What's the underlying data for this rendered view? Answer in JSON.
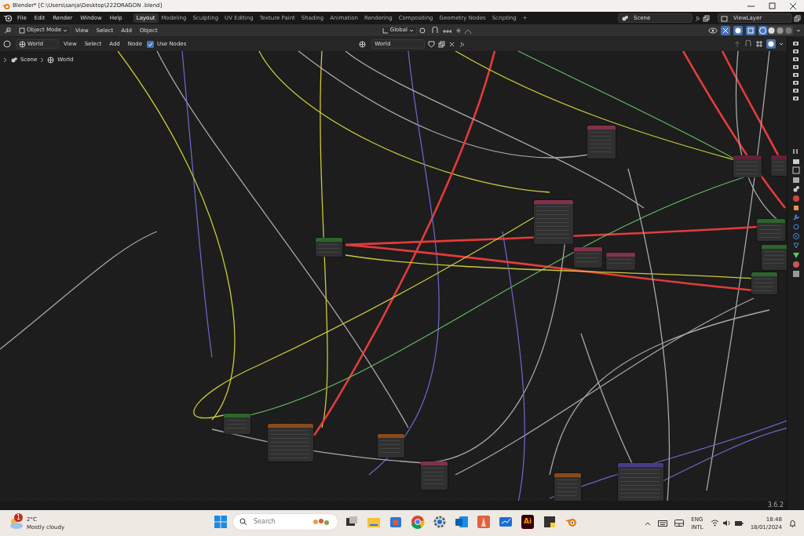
{
  "window": {
    "title": "Blender* [C:\\Users\\sanja\\Desktop\\222DRAGON .blend]"
  },
  "menus": [
    "File",
    "Edit",
    "Render",
    "Window",
    "Help"
  ],
  "workspaces": [
    {
      "label": "Layout",
      "selected": true
    },
    {
      "label": "Modeling",
      "selected": false
    },
    {
      "label": "Sculpting",
      "selected": false
    },
    {
      "label": "UV Editing",
      "selected": false
    },
    {
      "label": "Texture Paint",
      "selected": false
    },
    {
      "label": "Shading",
      "selected": false
    },
    {
      "label": "Animation",
      "selected": false
    },
    {
      "label": "Rendering",
      "selected": false
    },
    {
      "label": "Compositing",
      "selected": false
    },
    {
      "label": "Geometry Nodes",
      "selected": false
    },
    {
      "label": "Scripting",
      "selected": false
    }
  ],
  "add_workspace": "+",
  "scene": "Scene",
  "view_layer": "ViewLayer",
  "viewport_header": {
    "mode": "Object Mode",
    "menus": [
      "View",
      "Select",
      "Add",
      "Object"
    ],
    "orientation": "Global"
  },
  "node_header": {
    "world": "World",
    "menus": [
      "View",
      "Select",
      "Add",
      "Node"
    ],
    "use_nodes": {
      "label": "Use Nodes",
      "checked": true
    },
    "datablock": "World"
  },
  "breadcrumbs": [
    "Scene",
    "World"
  ],
  "version": "3.6.2",
  "taskbar": {
    "weather": {
      "temperature": "2°C",
      "condition": "Mostly cloudy",
      "badge": "1"
    },
    "search": {
      "placeholder": "Search"
    },
    "illustrator_label": "Ai",
    "language": [
      "ENG",
      "INTL"
    ],
    "time": "18:48",
    "date": "18/01/2024"
  }
}
